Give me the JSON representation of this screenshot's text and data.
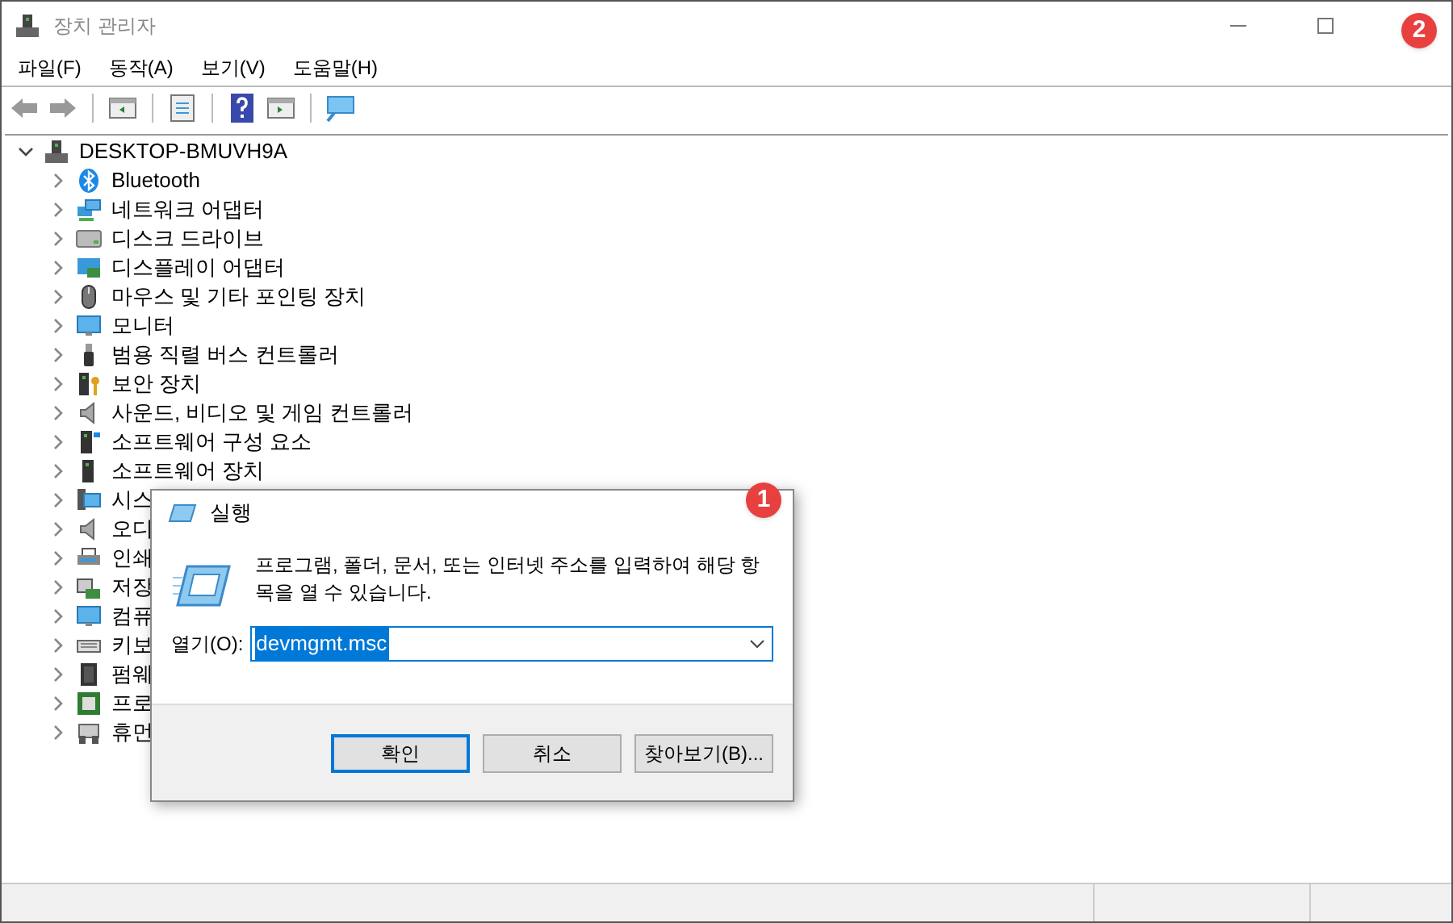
{
  "window": {
    "title": "장치 관리자"
  },
  "menu": [
    "파일(F)",
    "동작(A)",
    "보기(V)",
    "도움말(H)"
  ],
  "tree": {
    "label": "DESKTOP-BMUVH9A",
    "expanded": true,
    "children": [
      {
        "label": "Bluetooth",
        "expanded": false
      },
      {
        "label": "네트워크 어댑터",
        "expanded": false
      },
      {
        "label": "디스크 드라이브",
        "expanded": false
      },
      {
        "label": "디스플레이 어댑터",
        "expanded": false
      },
      {
        "label": "마우스 및 기타 포인팅 장치",
        "expanded": false
      },
      {
        "label": "모니터",
        "expanded": false
      },
      {
        "label": "범용 직렬 버스 컨트롤러",
        "expanded": false
      },
      {
        "label": "보안 장치",
        "expanded": false
      },
      {
        "label": "사운드, 비디오 및 게임 컨트롤러",
        "expanded": false
      },
      {
        "label": "소프트웨어 구성 요소",
        "expanded": false
      },
      {
        "label": "소프트웨어 장치",
        "expanded": false
      },
      {
        "label": "시스",
        "expanded": false
      },
      {
        "label": "오디",
        "expanded": false
      },
      {
        "label": "인쇄",
        "expanded": false
      },
      {
        "label": "저장",
        "expanded": false
      },
      {
        "label": "컴퓨",
        "expanded": false
      },
      {
        "label": "키보",
        "expanded": false
      },
      {
        "label": "펌웨",
        "expanded": false
      },
      {
        "label": "프로",
        "expanded": false
      },
      {
        "label": "휴먼",
        "expanded": false
      }
    ]
  },
  "run_dialog": {
    "title": "실행",
    "message": "프로그램, 폴더, 문서, 또는 인터넷 주소를 입력하여 해당 항목을 열 수 있습니다.",
    "open_label": "열기(O):",
    "value": "devmgmt.msc",
    "value_selected": true,
    "buttons": [
      {
        "label": "확인",
        "selected": true
      },
      {
        "label": "취소",
        "selected": false
      },
      {
        "label": "찾아보기(B)...",
        "selected": false
      }
    ]
  },
  "badges": [
    "1",
    "2"
  ]
}
